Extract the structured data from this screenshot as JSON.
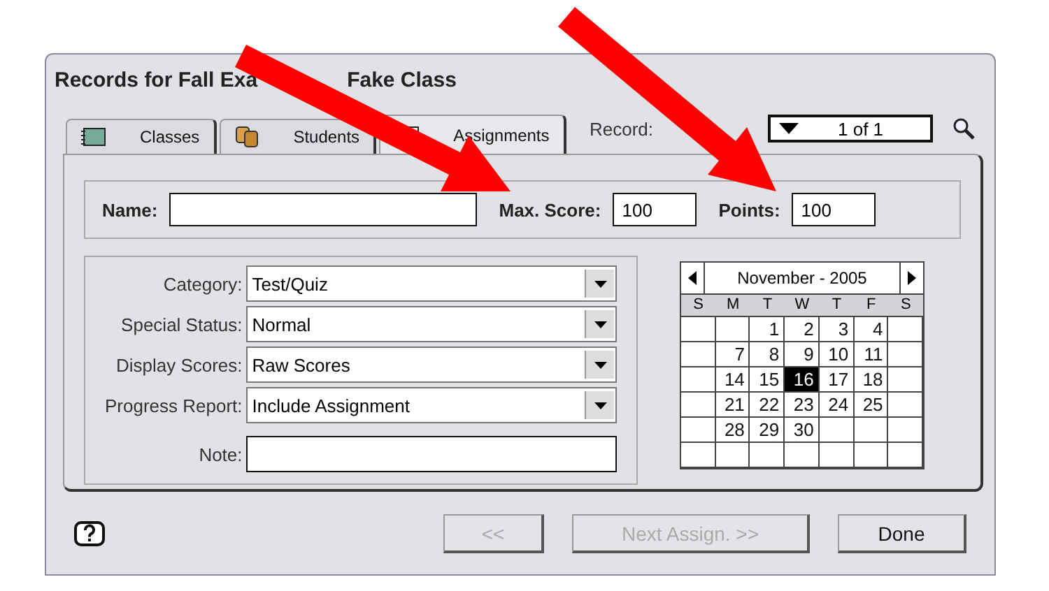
{
  "window": {
    "title_parts": [
      "Records for Fall Exa",
      "Fake Class"
    ]
  },
  "tabs": [
    {
      "label": "Classes",
      "selected": false,
      "kind": "classes"
    },
    {
      "label": "Students",
      "selected": false,
      "kind": "students"
    },
    {
      "label": "Assignments",
      "selected": true,
      "kind": "assignments"
    }
  ],
  "record": {
    "label": "Record:",
    "value": "1 of 1"
  },
  "header_fields": [
    {
      "label": "Name:",
      "kind": "wide"
    },
    {
      "label": "Max. Score:",
      "value": "100",
      "kind": "narrow"
    },
    {
      "label": "Points:",
      "value": "100",
      "kind": "narrow"
    }
  ],
  "dropdowns": [
    {
      "label": "Category:",
      "value": "Test/Quiz"
    },
    {
      "label": "Special Status:",
      "value": "Normal"
    },
    {
      "label": "Display Scores:",
      "value": "Raw Scores"
    },
    {
      "label": "Progress Report:",
      "value": "Include Assignment"
    }
  ],
  "note": {
    "label": "Note:"
  },
  "calendar": {
    "month": "November - 2005",
    "weekdays": [
      "S",
      "M",
      "T",
      "W",
      "T",
      "F",
      "S"
    ],
    "weeks": [
      [
        {
          "kind": "blank"
        },
        {
          "kind": "blank"
        },
        {
          "kind": "day",
          "day": "1",
          "selected": false
        },
        {
          "kind": "day",
          "day": "2",
          "selected": false
        },
        {
          "kind": "day",
          "day": "3",
          "selected": false
        },
        {
          "kind": "day",
          "day": "4",
          "selected": false
        },
        {
          "kind": "blank"
        }
      ],
      [
        {
          "kind": "blank"
        },
        {
          "kind": "day",
          "day": "7",
          "selected": false
        },
        {
          "kind": "day",
          "day": "8",
          "selected": false
        },
        {
          "kind": "day",
          "day": "9",
          "selected": false
        },
        {
          "kind": "day",
          "day": "10",
          "selected": false
        },
        {
          "kind": "day",
          "day": "11",
          "selected": false
        },
        {
          "kind": "blank"
        }
      ],
      [
        {
          "kind": "blank"
        },
        {
          "kind": "day",
          "day": "14",
          "selected": false
        },
        {
          "kind": "day",
          "day": "15",
          "selected": false
        },
        {
          "kind": "day",
          "day": "16",
          "selected": true
        },
        {
          "kind": "day",
          "day": "17",
          "selected": false
        },
        {
          "kind": "day",
          "day": "18",
          "selected": false
        },
        {
          "kind": "blank"
        }
      ],
      [
        {
          "kind": "blank"
        },
        {
          "kind": "day",
          "day": "21",
          "selected": false
        },
        {
          "kind": "day",
          "day": "22",
          "selected": false
        },
        {
          "kind": "day",
          "day": "23",
          "selected": false
        },
        {
          "kind": "day",
          "day": "24",
          "selected": false
        },
        {
          "kind": "day",
          "day": "25",
          "selected": false
        },
        {
          "kind": "blank"
        }
      ],
      [
        {
          "kind": "blank"
        },
        {
          "kind": "day",
          "day": "28",
          "selected": false
        },
        {
          "kind": "day",
          "day": "29",
          "selected": false
        },
        {
          "kind": "day",
          "day": "30",
          "selected": false
        },
        {
          "kind": "blank"
        },
        {
          "kind": "blank"
        },
        {
          "kind": "blank"
        }
      ],
      [
        {
          "kind": "blank"
        },
        {
          "kind": "blank"
        },
        {
          "kind": "blank"
        },
        {
          "kind": "blank"
        },
        {
          "kind": "blank"
        },
        {
          "kind": "blank"
        },
        {
          "kind": "blank"
        }
      ]
    ]
  },
  "buttons": [
    {
      "label": "<<",
      "disabled": true,
      "kind": "prev"
    },
    {
      "label": "Next Assign. >>",
      "disabled": true,
      "kind": "next"
    },
    {
      "label": "Done",
      "disabled": false,
      "kind": "done"
    }
  ]
}
